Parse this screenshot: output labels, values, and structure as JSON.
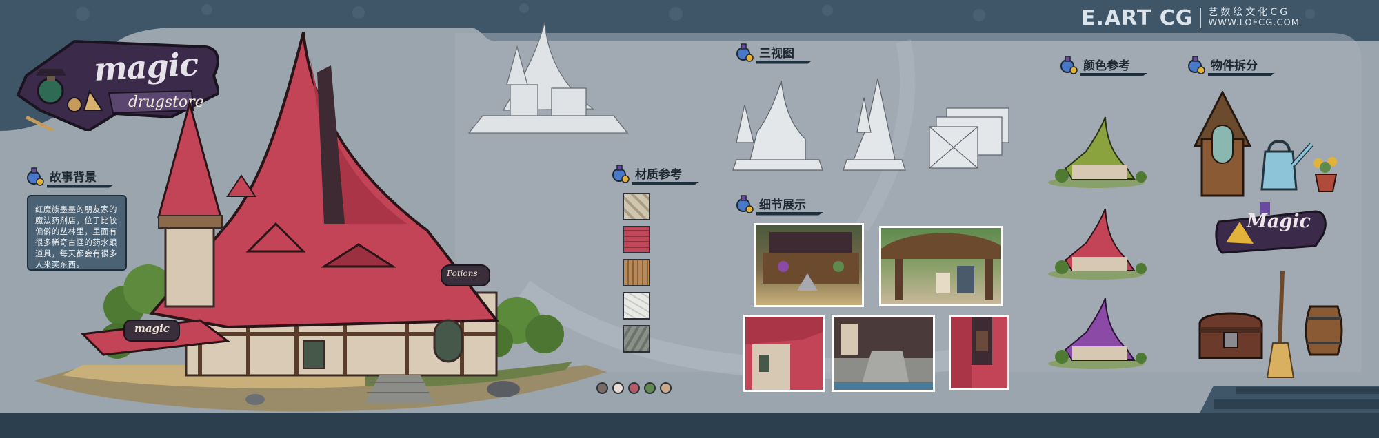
{
  "brand": {
    "name": "E.ART CG",
    "chinese": "艺数绘文化CG",
    "url": "WWW.LOFCG.COM"
  },
  "logo": {
    "word": "magic",
    "subtitle": "drugstore"
  },
  "sections": {
    "story": {
      "title": "故事背景",
      "text": "红魔族墨墨的朋友家的魔法药剂店，位于比较偏僻的丛林里，里面有很多稀奇古怪的药水跟道具，每天都会有很多人来买东西。"
    },
    "materials": {
      "title": "材质参考"
    },
    "three_view": {
      "title": "三视图"
    },
    "details": {
      "title": "细节展示"
    },
    "colors": {
      "title": "颜色参考"
    },
    "breakdown": {
      "title": "物件拆分"
    }
  },
  "building": {
    "sign_label": "Potions",
    "sign_magic": "magic"
  },
  "breakdown_sign": {
    "word": "Magic"
  },
  "material_swatches": [
    "stone",
    "roof-tile",
    "wood",
    "plaster",
    "cobblestone"
  ],
  "palette": [
    "#7a6a64",
    "#e8dcd4",
    "#b55a66",
    "#5e8a4e",
    "#c9a98a"
  ],
  "colors": {
    "bg_panel": "#9ba5ae",
    "bg_frame": "#3d5566",
    "roof_red": "#c24456",
    "roof_green": "#8aa33e",
    "roof_purple": "#8a4aa6"
  }
}
